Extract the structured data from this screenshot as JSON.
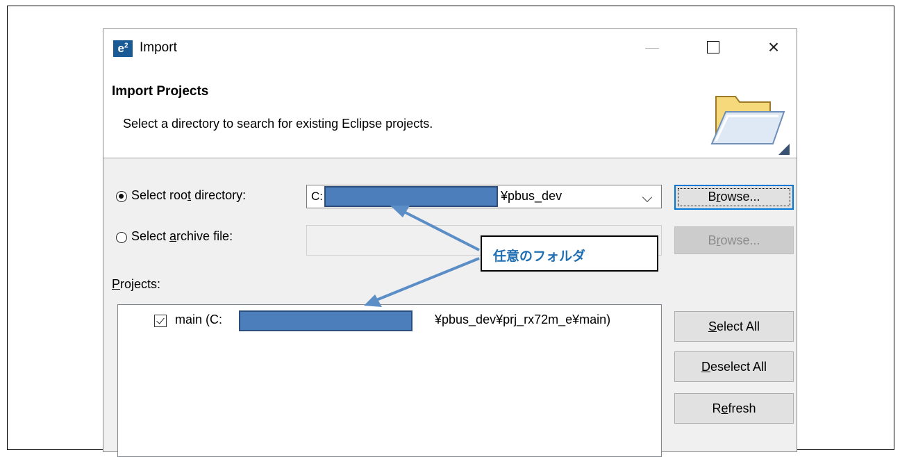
{
  "window": {
    "app_icon": "e²",
    "title": "Import",
    "minimize_icon": "minimize-icon",
    "maximize_icon": "maximize-icon",
    "close_glyph": "×"
  },
  "header": {
    "title": "Import Projects",
    "description": "Select a directory to search for existing Eclipse projects.",
    "icon": "folder-icon"
  },
  "source": {
    "root_option": {
      "before": "Select roo",
      "accel": "t",
      "after": " directory:",
      "selected": true
    },
    "root_value_prefix": "C:",
    "root_value_suffix": "¥pbus_dev",
    "archive_option": {
      "before": "Select ",
      "accel": "a",
      "after": "rchive file:",
      "selected": false
    },
    "archive_value": "",
    "browse_root": {
      "before": "B",
      "accel": "r",
      "after": "owse..."
    },
    "browse_archive": {
      "before": "B",
      "accel": "r",
      "after": "owse..."
    }
  },
  "projects": {
    "label": {
      "accel": "P",
      "after": "rojects:"
    },
    "items": [
      {
        "checked": true,
        "prefix": "main (C:",
        "suffix": "¥pbus_dev¥prj_rx72m_e¥main)"
      }
    ]
  },
  "buttons": {
    "select_all": {
      "accel": "S",
      "after": "elect All"
    },
    "deselect_all": {
      "accel": "D",
      "after": "eselect All"
    },
    "refresh": {
      "before": "R",
      "accel": "e",
      "after": "fresh"
    }
  },
  "annotation": {
    "callout_text": "任意のフォルダ"
  },
  "colors": {
    "redaction": "#4b7ebb",
    "callout_text": "#1f6fb2",
    "default_button_border": "#0078d7"
  }
}
